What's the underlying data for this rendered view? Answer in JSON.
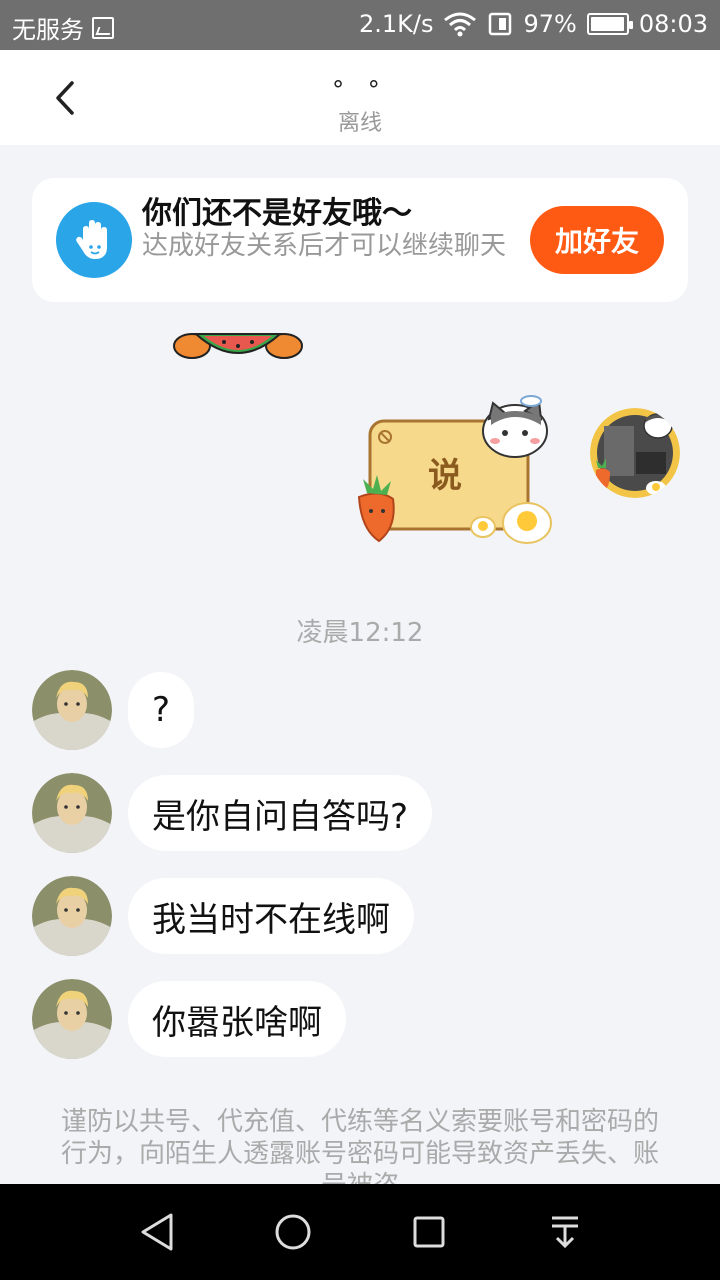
{
  "status_bar": {
    "carrier": "无服务",
    "network_speed": "2.1K/s",
    "battery_percent": "97%",
    "battery_level": 0.97,
    "time": "08:03"
  },
  "header": {
    "title": "° °",
    "subtitle": "离线"
  },
  "friend_banner": {
    "title": "你们还不是好友哦～",
    "description": "达成好友关系后才可以继续聊天",
    "button_label": "加好友"
  },
  "sticker_message": {
    "text": "说"
  },
  "timestamp": "凌晨12:12",
  "messages": [
    {
      "text": "?"
    },
    {
      "text": "是你自问自答吗?"
    },
    {
      "text": "我当时不在线啊"
    },
    {
      "text": "你嚣张啥啊"
    }
  ],
  "notice": "谨防以共号、代充值、代练等名义索要账号和密码的行为，向陌生人透露账号密码可能导致资产丢失、账号被盗",
  "colors": {
    "accent": "#ff5a14",
    "banner_icon": "#2aa5e8",
    "background": "#f3f4f8"
  },
  "icons": {
    "back": "chevron-left-icon",
    "banner": "hand-wave-icon",
    "nav_back": "triangle-back-icon",
    "nav_home": "circle-home-icon",
    "nav_recent": "square-recent-icon",
    "nav_notifications": "pull-down-icon"
  }
}
